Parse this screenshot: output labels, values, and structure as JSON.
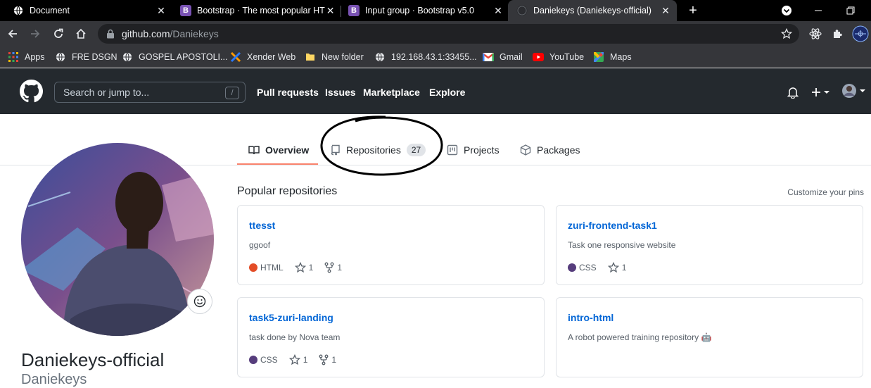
{
  "browser": {
    "tabs": [
      {
        "title": "Document",
        "favicon": "globe-icon"
      },
      {
        "title": "Bootstrap · The most popular HTML",
        "favicon": "bootstrap-icon"
      },
      {
        "title": "Input group · Bootstrap v5.0",
        "favicon": "bootstrap-icon"
      },
      {
        "title": "Daniekeys (Daniekeys-official)",
        "favicon": "github-icon"
      }
    ],
    "bootstrap_letter": "B",
    "url_host": "github.com",
    "url_path": "/Daniekeys",
    "bookmarks": [
      "Apps",
      "FRE DSGN",
      "GOSPEL APOSTOLI...",
      "Xender Web",
      "New folder",
      "192.168.43.1:33455...",
      "Gmail",
      "YouTube",
      "Maps"
    ]
  },
  "github": {
    "search_placeholder": "Search or jump to...",
    "search_shortcut": "/",
    "nav": [
      "Pull requests",
      "Issues",
      "Marketplace",
      "Explore"
    ],
    "profile_tabs": [
      {
        "label": "Overview",
        "icon": "book-icon",
        "active": true
      },
      {
        "label": "Repositories",
        "icon": "repo-icon",
        "count": "27"
      },
      {
        "label": "Projects",
        "icon": "project-icon"
      },
      {
        "label": "Packages",
        "icon": "package-icon"
      }
    ],
    "profile": {
      "full_name": "Daniekeys-official",
      "username": "Daniekeys"
    },
    "popular": {
      "title": "Popular repositories",
      "customize": "Customize your pins",
      "repos": [
        {
          "name": "ttesst",
          "description": "ggoof",
          "language": "HTML",
          "language_color": "#e34c26",
          "stars": "1",
          "forks": "1"
        },
        {
          "name": "zuri-frontend-task1",
          "description": "Task one responsive website",
          "language": "CSS",
          "language_color": "#563d7c",
          "stars": "1"
        },
        {
          "name": "task5-zuri-landing",
          "description": "task done by Nova team",
          "language": "CSS",
          "language_color": "#563d7c",
          "stars": "1",
          "forks": "1"
        },
        {
          "name": "intro-html",
          "description": "A robot powered training repository 🤖"
        }
      ]
    }
  },
  "colors": {
    "chrome_dark": "#000000",
    "chrome_toolbar": "#35363a",
    "github_header": "#24292e",
    "link_blue": "#0366d6",
    "tab_underline": "#f9826c"
  }
}
